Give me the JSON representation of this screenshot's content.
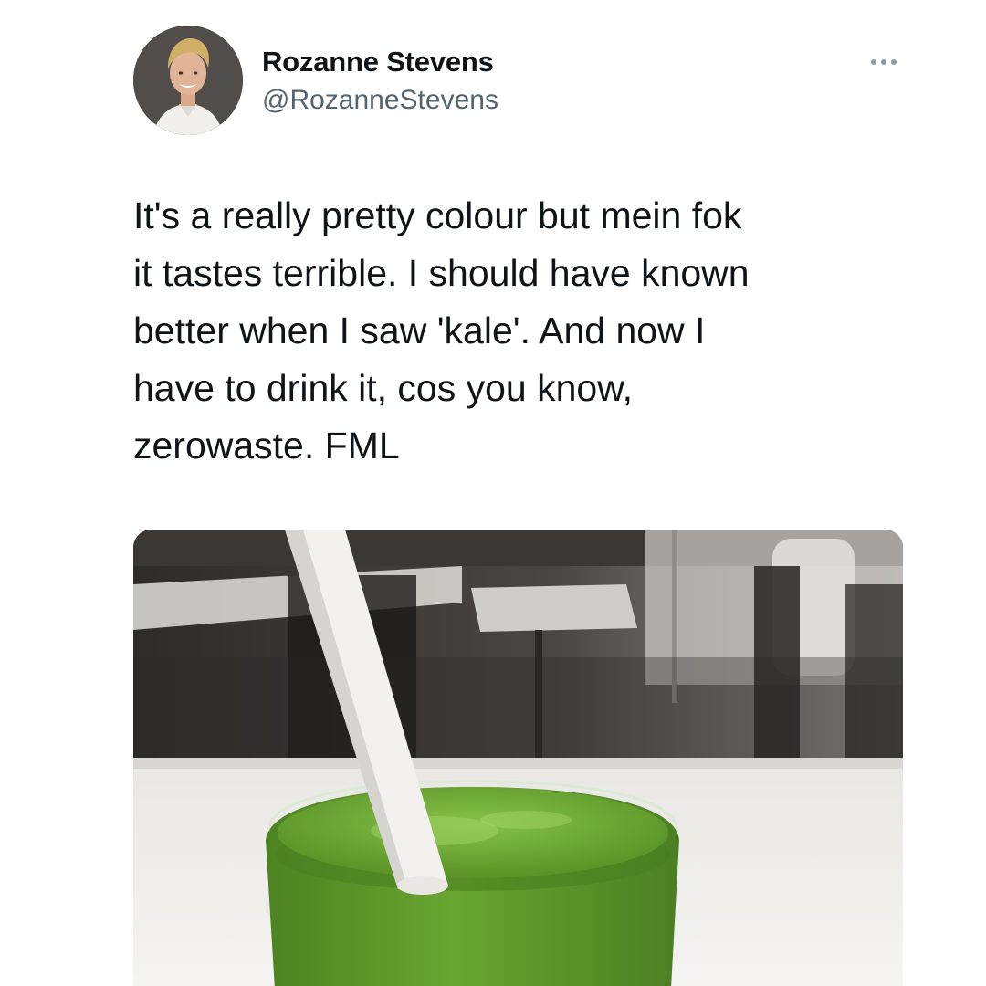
{
  "tweet": {
    "author": {
      "display_name": "Rozanne Stevens",
      "handle": "@RozanneStevens"
    },
    "more_icon": "more-horizontal-icon",
    "text_lines": [
      "It's a really pretty colour but mein fok",
      "it tastes terrible. I should have known",
      "better when I saw 'kale'. And now I",
      "have to drink it, cos you know,",
      "zerowaste. FML"
    ],
    "media": {
      "subject": "green smoothie in a glass with a white paper straw on a cafe table"
    }
  },
  "colors": {
    "text_primary": "#0f1419",
    "text_secondary": "#536471",
    "smoothie_green": "#5c9a2a"
  }
}
